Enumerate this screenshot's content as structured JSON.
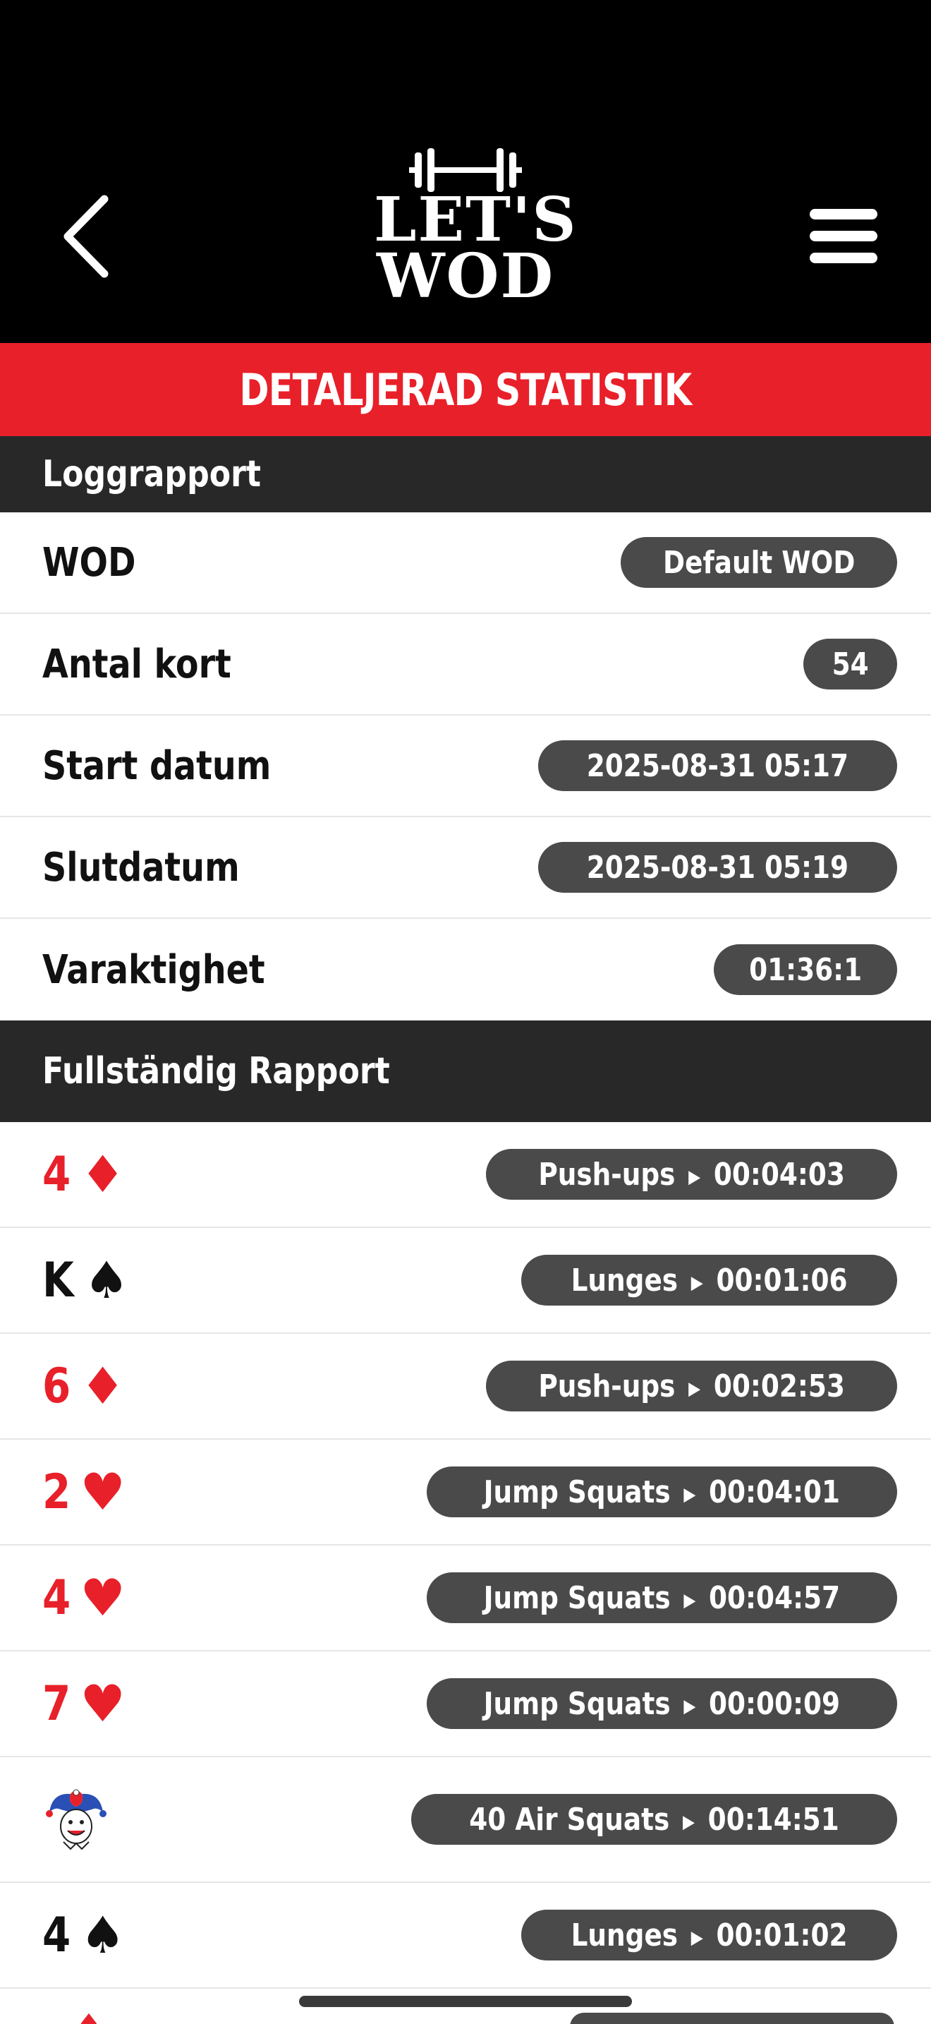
{
  "header": {
    "logo_line1": "LET'S",
    "logo_line2": "WOD"
  },
  "title": "DETALJERAD STATISTIK",
  "log_report": {
    "heading": "Loggrapport",
    "rows": [
      {
        "label": "WOD",
        "value": "Default WOD"
      },
      {
        "label": "Antal kort",
        "value": "54"
      },
      {
        "label": "Start datum",
        "value": "2025-08-31 05:17"
      },
      {
        "label": "Slutdatum",
        "value": "2025-08-31 05:19"
      },
      {
        "label": "Varaktighet",
        "value": "01:36:1"
      }
    ]
  },
  "full_report": {
    "heading": "Fullständig Rapport",
    "cards": [
      {
        "rank": "4",
        "suit": "♦",
        "color": "red",
        "exercise": "Push-ups",
        "time": "00:04:03"
      },
      {
        "rank": "K",
        "suit": "♠",
        "color": "black",
        "exercise": "Lunges",
        "time": "00:01:06"
      },
      {
        "rank": "6",
        "suit": "♦",
        "color": "red",
        "exercise": "Push-ups",
        "time": "00:02:53"
      },
      {
        "rank": "2",
        "suit": "♥",
        "color": "red",
        "exercise": "Jump Squats",
        "time": "00:04:01"
      },
      {
        "rank": "4",
        "suit": "♥",
        "color": "red",
        "exercise": "Jump Squats",
        "time": "00:04:57"
      },
      {
        "rank": "7",
        "suit": "♥",
        "color": "red",
        "exercise": "Jump Squats",
        "time": "00:00:09"
      },
      {
        "rank": "",
        "suit": "joker-icon",
        "color": "multi",
        "exercise": "40 Air Squats",
        "time": "00:14:51"
      },
      {
        "rank": "4",
        "suit": "♠",
        "color": "black",
        "exercise": "Lunges",
        "time": "00:01:02"
      }
    ]
  },
  "colors": {
    "brand_red": "#e8202a",
    "header_black": "#000000",
    "section_dark": "#282828",
    "pill_gray": "#4a4a4a"
  },
  "icons": {
    "back": "chevron-left-icon",
    "menu": "hamburger-menu-icon",
    "logo": "barbell-icon"
  }
}
